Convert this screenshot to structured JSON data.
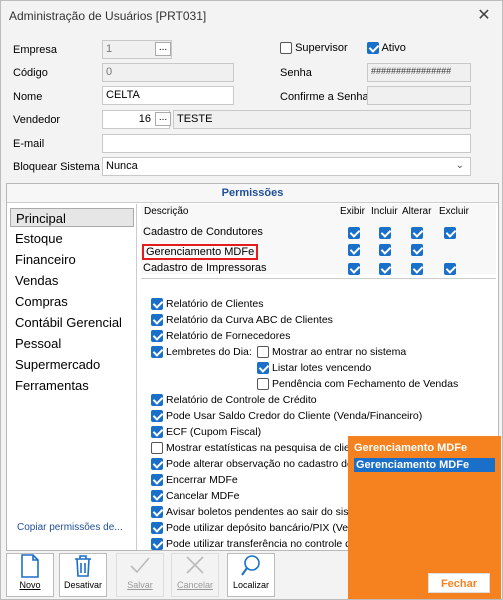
{
  "window": {
    "title": "Administração de Usuários [PRT031]"
  },
  "form": {
    "empresa_label": "Empresa",
    "empresa_value": "1",
    "codigo_label": "Código",
    "codigo_value": "0",
    "nome_label": "Nome",
    "nome_value": "CELTA",
    "vendedor_label": "Vendedor",
    "vendedor_code": "16",
    "vendedor_name": "TESTE",
    "email_label": "E-mail",
    "email_value": "",
    "bloquear_label": "Bloquear Sistema",
    "bloquear_value": "Nunca",
    "supervisor_label": "Supervisor",
    "supervisor_checked": false,
    "ativo_label": "Ativo",
    "ativo_checked": true,
    "senha_label": "Senha",
    "senha_value": "################",
    "confirme_label": "Confirme a Senha",
    "confirme_value": "",
    "dots": "..."
  },
  "permissoes": {
    "title": "Permissões",
    "modules": [
      "Principal",
      "Estoque",
      "Financeiro",
      "Vendas",
      "Compras",
      "Contábil Gerencial",
      "Pessoal",
      "Supermercado",
      "Ferramentas"
    ],
    "selected_module": "Principal",
    "copy_link": "Copiar permissões de...",
    "grid_headers": {
      "descricao": "Descrição",
      "exibir": "Exibir",
      "incluir": "Incluir",
      "alterar": "Alterar",
      "excluir": "Excluir"
    },
    "grid_rows": [
      {
        "label": "Cadastro de Condutores",
        "exibir": true,
        "incluir": true,
        "alterar": true,
        "excluir": true
      },
      {
        "label": "Gerenciamento MDFe",
        "exibir": true,
        "incluir": true,
        "alterar": true,
        "excluir": false
      },
      {
        "label": "Cadastro de Impressoras",
        "exibir": true,
        "incluir": true,
        "alterar": true,
        "excluir": true
      }
    ],
    "options": [
      {
        "label": "Relatório de Clientes",
        "checked": true
      },
      {
        "label": "Relatório da Curva ABC de Clientes",
        "checked": true
      },
      {
        "label": "Relatório de Fornecedores",
        "checked": true
      },
      {
        "label": "Lembretes do Dia:",
        "checked": true
      },
      {
        "label": "Mostrar ao entrar no sistema",
        "checked": false
      },
      {
        "label": "Listar lotes vencendo",
        "checked": true
      },
      {
        "label": "Pendência com Fechamento de Vendas",
        "checked": false
      },
      {
        "label": "Relatório de Controle de Crédito",
        "checked": true
      },
      {
        "label": "Pode Usar Saldo Credor do Cliente (Venda/Financeiro)",
        "checked": true
      },
      {
        "label": "ECF (Cupom Fiscal)",
        "checked": true
      },
      {
        "label": "Mostrar estatísticas na pesquisa de client",
        "checked": false
      },
      {
        "label": "Pode alterar observação no cadastro de",
        "checked": true
      },
      {
        "label": "Encerrar MDFe",
        "checked": true
      },
      {
        "label": "Cancelar MDFe",
        "checked": true
      },
      {
        "label": "Avisar boletos pendentes ao sair do siste",
        "checked": true
      },
      {
        "label": "Pode utilizar depósito bancário/PIX (Vend",
        "checked": true
      },
      {
        "label": "Pode utilizar transferência no controle de",
        "checked": true
      }
    ]
  },
  "toolbar": {
    "novo": "Novo",
    "desativar": "Desativar",
    "salvar": "Salvar",
    "cancelar": "Cancelar",
    "localizar": "Localizar"
  },
  "popup": {
    "title": "Gerenciamento MDFe",
    "items": [
      "Gerenciamento MDFe"
    ],
    "button": "Fechar"
  },
  "colors": {
    "accent": "#1a6fc9",
    "popup": "#f5821f",
    "highlight_border": "#e21b1b"
  }
}
